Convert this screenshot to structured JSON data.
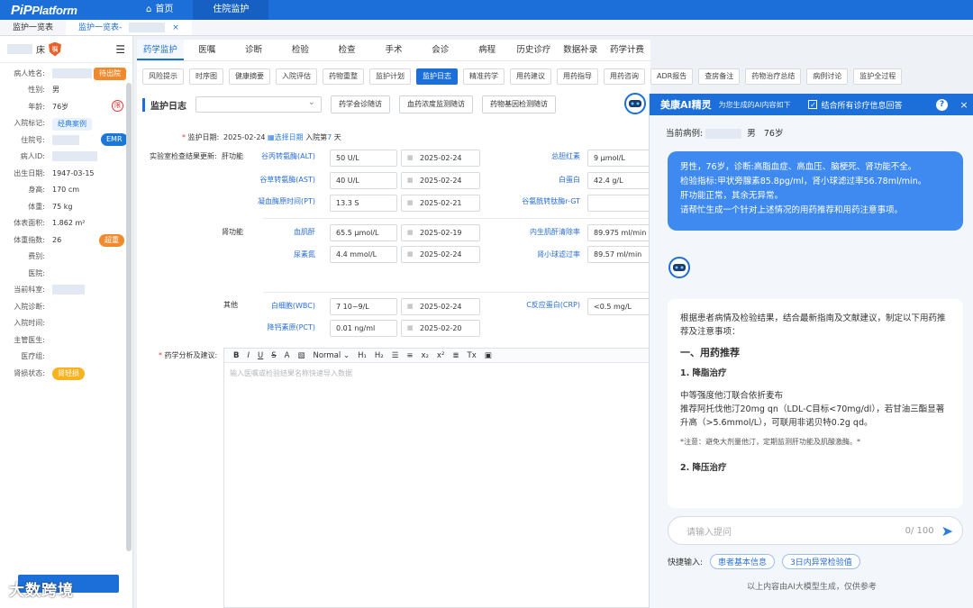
{
  "app": {
    "logo_main": "PiP",
    "logo_sub": "Platform",
    "nav": [
      {
        "label": "首页",
        "icon": "home-icon"
      },
      {
        "label": "住院监护"
      }
    ]
  },
  "tabs": [
    {
      "label": "监护一览表"
    },
    {
      "label": "监护一览表-",
      "close": "×"
    }
  ],
  "patient": {
    "bed_suffix": "床",
    "shield_text": "嘱",
    "fields": [
      {
        "k": "病人姓名:",
        "v": ""
      },
      {
        "k": "性别:",
        "v": "男"
      },
      {
        "k": "年龄:",
        "v": "76岁"
      },
      {
        "k": "入院标记:",
        "v": ""
      },
      {
        "k": "住院号:",
        "v": ""
      },
      {
        "k": "病人ID:",
        "v": ""
      },
      {
        "k": "出生日期:",
        "v": "1947-03-15"
      },
      {
        "k": "身高:",
        "v": "170 cm"
      },
      {
        "k": "体重:",
        "v": "75 kg"
      },
      {
        "k": "体表面积:",
        "v": "1.862 m²"
      },
      {
        "k": "体重指数:",
        "v": "26"
      },
      {
        "k": "费别:",
        "v": ""
      },
      {
        "k": "医院:",
        "v": ""
      },
      {
        "k": "当前科室:",
        "v": ""
      },
      {
        "k": "入院诊断:",
        "v": ""
      },
      {
        "k": "入院时间:",
        "v": ""
      },
      {
        "k": "主管医生:",
        "v": ""
      },
      {
        "k": "医疗组:",
        "v": ""
      },
      {
        "k": "肾损状态:",
        "v": ""
      }
    ],
    "badges": {
      "discharge": "待出院",
      "classic": "经典案例",
      "emr": "EMR",
      "overweight": "超重",
      "kidney": "肾轻损",
      "stamp": "限"
    }
  },
  "main_tabs": [
    "药学监护",
    "医嘱",
    "诊断",
    "检验",
    "检查",
    "手术",
    "会诊",
    "病程",
    "历史诊疗",
    "数据补录",
    "药学计费"
  ],
  "chips": [
    "风险提示",
    "时序图",
    "健康摘要",
    "入院评估",
    "药物重整",
    "监护计划",
    "监护日志",
    "精准药学",
    "用药建议",
    "用药指导",
    "用药咨询",
    "ADR报告",
    "查房备注",
    "药物治疗总结",
    "病例讨论",
    "监护全过程"
  ],
  "log": {
    "title": "监护日志",
    "btn1": "药学会诊随访",
    "btn2": "血药浓度监测随访",
    "btn3": "药物基因检测随访",
    "date_label": "监护日期:",
    "date_value": "2025-02-24",
    "pick_date": "选择日期",
    "admit_prefix": "入院第",
    "admit_day": "7",
    "admit_suffix": "天",
    "lab_label": "实验室检查结果更新:",
    "sec_liver": "肝功能",
    "sec_kidney": "肾功能",
    "sec_other": "其他",
    "pharm_label": "药学分析及建议:",
    "editor_placeholder": "输入医嘱或检验结果名称快速导入数据",
    "editor_format": "Normal"
  },
  "labs": {
    "alt": {
      "name": "谷丙转氨酶(ALT)",
      "value": "50 U/L",
      "date": "2025-02-24"
    },
    "ast": {
      "name": "谷草转氨酶(AST)",
      "value": "40 U/L",
      "date": "2025-02-24"
    },
    "pt": {
      "name": "凝血酶原时间(PT)",
      "value": "13.3 S",
      "date": "2025-02-21"
    },
    "tbil": {
      "name": "总胆红素",
      "value": "9 μmol/L"
    },
    "alb": {
      "name": "白蛋白",
      "value": "42.4 g/L"
    },
    "ggt": {
      "name": "谷氨酰转肽酶r-GT",
      "value": ""
    },
    "cr": {
      "name": "血肌酐",
      "value": "65.5 μmol/L",
      "date": "2025-02-19"
    },
    "bun": {
      "name": "尿素氮",
      "value": "4.4 mmol/L",
      "date": "2025-02-24"
    },
    "ccr": {
      "name": "内生肌酐清除率",
      "value": "89.975 ml/min"
    },
    "gfr": {
      "name": "肾小球滤过率",
      "value": "89.57 ml/min"
    },
    "wbc": {
      "name": "白细胞(WBC)",
      "value": "7 10~9/L",
      "date": "2025-02-24"
    },
    "pct": {
      "name": "降钙素原(PCT)",
      "value": "0.01 ng/ml",
      "date": "2025-02-20"
    },
    "crp": {
      "name": "C反应蛋白(CRP)",
      "value": "<0.5 mg/L"
    }
  },
  "ai": {
    "title": "美康AI精灵",
    "subtitle": "为您生成的AI内容如下",
    "combine": "结合所有诊疗信息回答",
    "help": "?",
    "close": "×",
    "case_label": "当前病例:",
    "case_sex": "男",
    "case_age": "76岁",
    "user_msg": [
      "男性，76岁，诊断:高脂血症、高血压、脑梗死、肾功能不全。",
      "检验指标:甲状旁腺素85.8pg/ml，肾小球滤过率56.78ml/min。",
      "肝功能正常，其余无异常。",
      "请帮忙生成一个针对上述情况的用药推荐和用药注意事项。"
    ],
    "reply_intro": "根据患者病情及检验结果，结合最新指南及文献建议，制定以下用药推荐及注意事项：",
    "reply_h1": "一、用药推荐",
    "reply_h2": "1. 降脂治疗",
    "reply_p1": "中等强度他汀联合依折麦布",
    "reply_p2": "推荐阿托伐他汀20mg qn（LDL-C目标<70mg/dl），若甘油三酯显著升高（>5.6mmol/L），可联用非诺贝特0.2g qd。",
    "reply_note": "*注意：避免大剂量他汀，定期监测肝功能及肌酸激酶。*",
    "reply_h3": "2. 降压治疗",
    "ask_placeholder": "请输入提问",
    "ask_count": "0/ 100",
    "quick_label": "快捷输入:",
    "quick1": "患者基本信息",
    "quick2": "3日内异常检验值",
    "footer": "以上内容由AI大模型生成，仅供参考"
  },
  "watermark": "大数跨境",
  "colors": {
    "primary": "#1c6fd8",
    "orange": "#f08a2c",
    "yellow": "#f7b21d"
  }
}
